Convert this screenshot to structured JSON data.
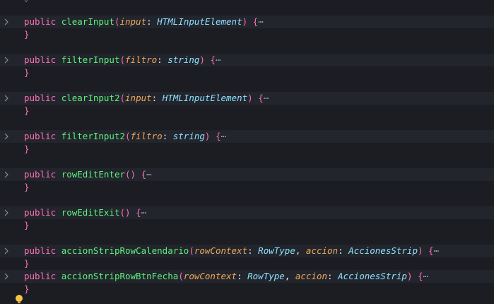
{
  "editor": {
    "top_fold_marker": "⌄",
    "lines": [
      {
        "kind": "signature",
        "keyword": "public",
        "name": "clearInput",
        "params": [
          {
            "name": "input",
            "type": "HTMLInputElement"
          }
        ],
        "open": "{",
        "ellipsis": "⋯"
      },
      {
        "kind": "close",
        "text": "}"
      },
      {
        "kind": "signature",
        "keyword": "public",
        "name": "filterInput",
        "params": [
          {
            "name": "filtro",
            "type": "string"
          }
        ],
        "open": "{",
        "ellipsis": "⋯"
      },
      {
        "kind": "close",
        "text": "}"
      },
      {
        "kind": "signature",
        "keyword": "public",
        "name": "clearInput2",
        "params": [
          {
            "name": "input",
            "type": "HTMLInputElement"
          }
        ],
        "open": "{",
        "ellipsis": "⋯"
      },
      {
        "kind": "close",
        "text": "}"
      },
      {
        "kind": "signature",
        "keyword": "public",
        "name": "filterInput2",
        "params": [
          {
            "name": "filtro",
            "type": "string"
          }
        ],
        "open": "{",
        "ellipsis": "⋯"
      },
      {
        "kind": "close",
        "text": "}"
      },
      {
        "kind": "signature",
        "keyword": "public",
        "name": "rowEditEnter",
        "params": [],
        "open": "{",
        "ellipsis": "⋯"
      },
      {
        "kind": "close",
        "text": "}"
      },
      {
        "kind": "signature",
        "keyword": "public",
        "name": "rowEditExit",
        "params": [],
        "open": "{",
        "ellipsis": "⋯"
      },
      {
        "kind": "close",
        "text": "}"
      },
      {
        "kind": "signature",
        "keyword": "public",
        "name": "accionStripRowCalendario",
        "params": [
          {
            "name": "rowContext",
            "type": "RowType"
          },
          {
            "name": "accion",
            "type": "AccionesStrip"
          }
        ],
        "open": "{",
        "ellipsis": "⋯"
      },
      {
        "kind": "close",
        "text": "}"
      },
      {
        "kind": "signature",
        "keyword": "public",
        "name": "accionStripRowBtnFecha",
        "params": [
          {
            "name": "rowContext",
            "type": "RowType"
          },
          {
            "name": "accion",
            "type": "AccionesStrip"
          }
        ],
        "open": "{",
        "ellipsis": "⋯"
      },
      {
        "kind": "close",
        "text": "}"
      }
    ]
  },
  "colors": {
    "background": "#1b1d23",
    "keyword": "#ff6eb4",
    "function": "#5cf27c",
    "parameter": "#f2a85a",
    "type": "#8ee1ff",
    "lightbulb": "#f5c542"
  },
  "icons": {
    "fold_chevron": "chevron-right-icon",
    "code_action": "lightbulb-icon"
  }
}
